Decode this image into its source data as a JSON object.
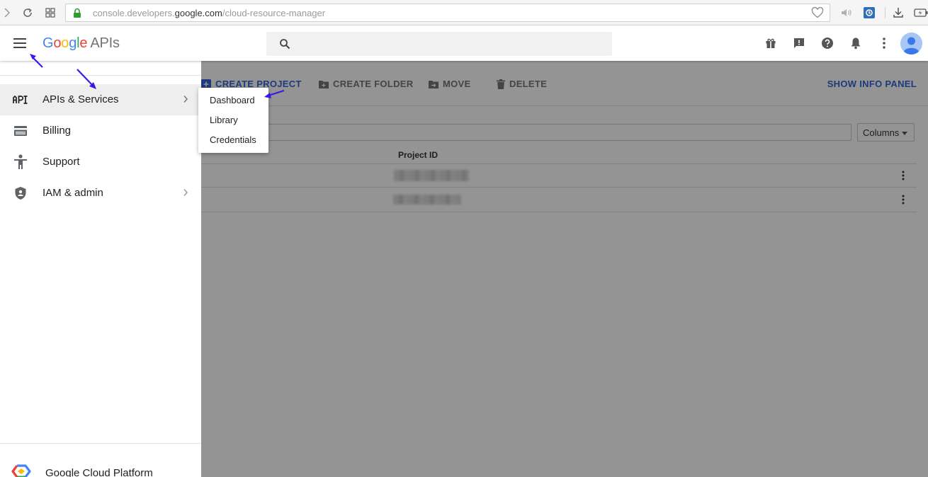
{
  "browser": {
    "url_prefix": "console.developers.",
    "url_domain": "google.com",
    "url_path": "/cloud-resource-manager"
  },
  "header": {
    "logo_letters": [
      "G",
      "o",
      "o",
      "g",
      "l",
      "e"
    ],
    "logo_suffix": "APIs",
    "search_placeholder": ""
  },
  "toolbar": {
    "create_project": "CREATE PROJECT",
    "create_folder": "CREATE FOLDER",
    "move": "MOVE",
    "delete": "DELETE",
    "show_info_panel": "SHOW INFO PANEL"
  },
  "table": {
    "columns_button": "Columns",
    "header_project_id": "Project ID"
  },
  "nav": {
    "items": [
      {
        "label": "APIs & Services",
        "icon": "api-icon",
        "has_submenu": true,
        "active": true
      },
      {
        "label": "Billing",
        "icon": "billing-icon",
        "has_submenu": false,
        "active": false
      },
      {
        "label": "Support",
        "icon": "support-icon",
        "has_submenu": false,
        "active": false
      },
      {
        "label": "IAM & admin",
        "icon": "shield-icon",
        "has_submenu": true,
        "active": false
      }
    ],
    "footer_label": "Google Cloud Platform"
  },
  "submenu": {
    "items": [
      "Dashboard",
      "Library",
      "Credentials"
    ]
  },
  "colors": {
    "accent": "#3367d6",
    "annotation_arrow": "#3d16e8",
    "overlay": "rgba(0,0,0,0.42)"
  }
}
